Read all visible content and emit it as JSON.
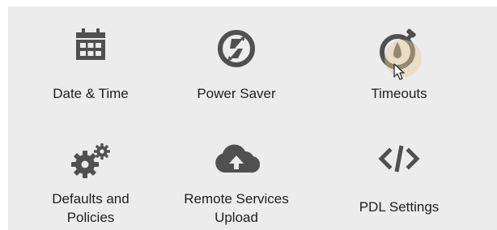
{
  "colors": {
    "panel_bg": "#ececec",
    "icon": "#505050",
    "text": "#202020"
  },
  "tiles": [
    {
      "label": "Date & Time",
      "icon": "calendar-icon"
    },
    {
      "label": "Power Saver",
      "icon": "power-saver-icon"
    },
    {
      "label": "Timeouts",
      "icon": "stopwatch-icon"
    },
    {
      "label_line1": "Defaults and",
      "label_line2": "Policies",
      "icon": "gears-icon"
    },
    {
      "label_line1": "Remote Services",
      "label_line2": "Upload",
      "icon": "cloud-upload-icon"
    },
    {
      "label": "PDL Settings",
      "icon": "code-icon"
    }
  ]
}
